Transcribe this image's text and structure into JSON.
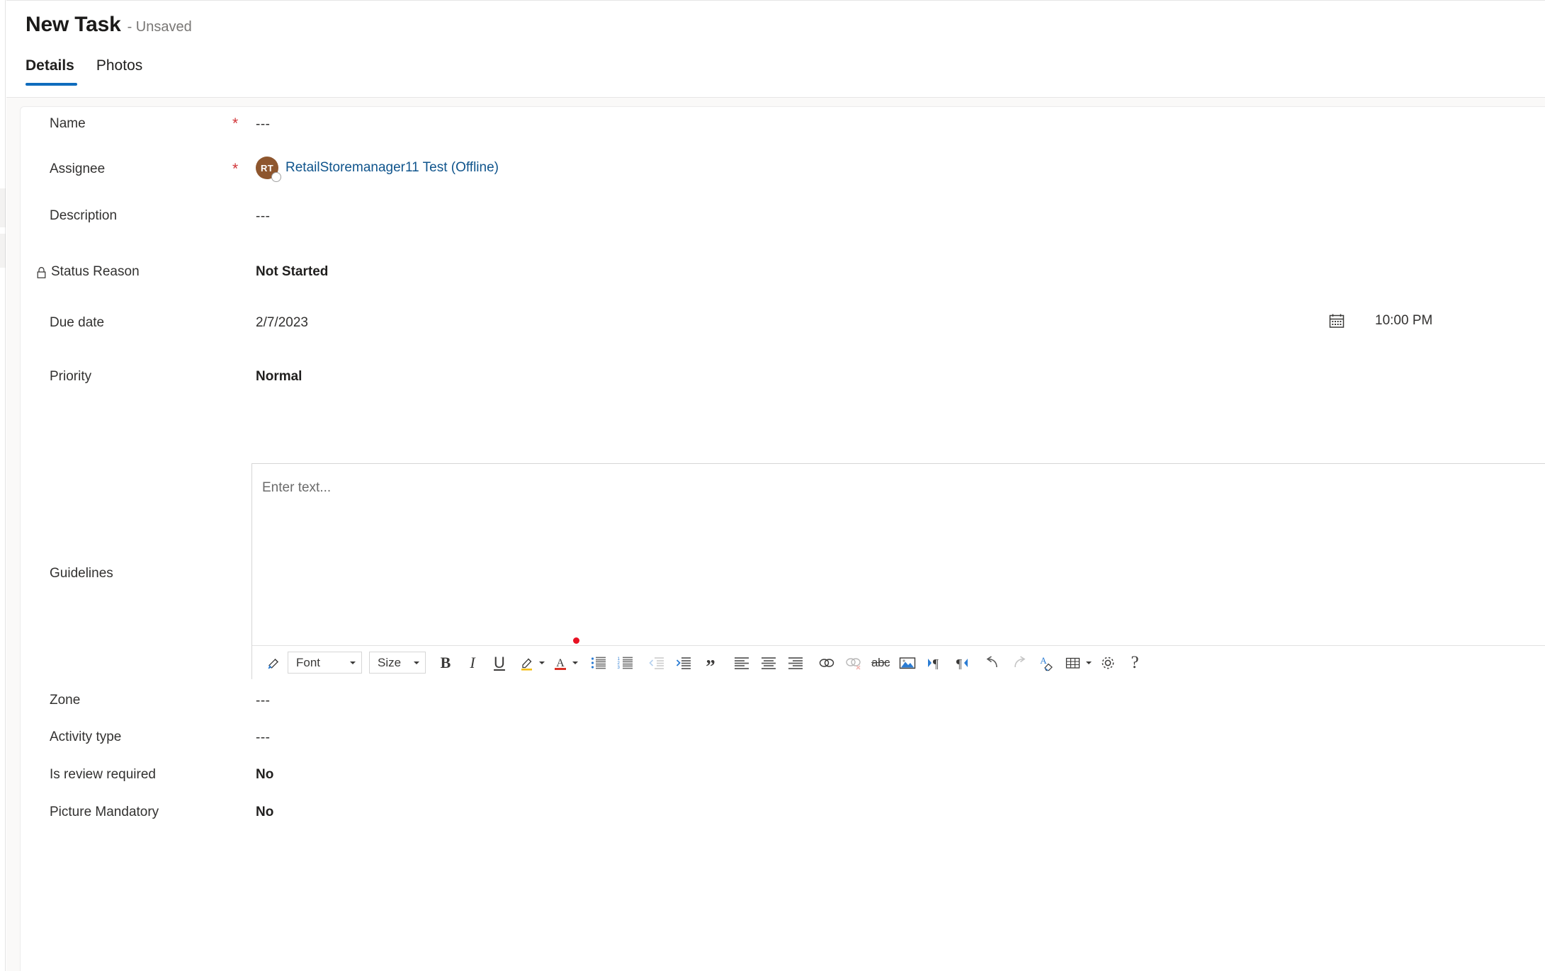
{
  "header": {
    "title": "New Task",
    "subtitle": "- Unsaved",
    "tabs": [
      {
        "label": "Details",
        "active": true
      },
      {
        "label": "Photos",
        "active": false
      }
    ]
  },
  "form": {
    "fields": [
      {
        "label": "Name",
        "required": true,
        "value": "---",
        "style": "dashes"
      },
      {
        "label": "Assignee",
        "required": true,
        "value": "RetailStoremanager11 Test (Offline)",
        "avatar_initials": "RT",
        "presence": "offline",
        "style": "link"
      },
      {
        "label": "Description",
        "required": false,
        "value": "---",
        "style": "dashes"
      },
      {
        "label": "Status Reason",
        "required": false,
        "value": "Not Started",
        "locked": true,
        "style": "bold"
      },
      {
        "label": "Due date",
        "required": false,
        "value": "2/7/2023",
        "time": "10:00 PM",
        "style": "plain"
      },
      {
        "label": "Priority",
        "required": false,
        "value": "Normal",
        "style": "bold"
      },
      {
        "label": "Guidelines",
        "required": false,
        "value": "",
        "style": "richtext"
      },
      {
        "label": "Zone",
        "required": false,
        "value": "---",
        "style": "dashes"
      },
      {
        "label": "Activity type",
        "required": false,
        "value": "---",
        "style": "dashes"
      },
      {
        "label": "Is review required",
        "required": false,
        "value": "No",
        "style": "bold"
      },
      {
        "label": "Picture Mandatory",
        "required": false,
        "value": "No",
        "style": "bold"
      }
    ],
    "required_marker": "*"
  },
  "editor": {
    "placeholder": "Enter text...",
    "toolbar": {
      "font_label": "Font",
      "size_label": "Size",
      "buttons": [
        "format-painter",
        "bold",
        "italic",
        "underline",
        "text-highlight",
        "font-color",
        "bulleted-list",
        "numbered-list",
        "decrease-indent",
        "increase-indent",
        "blockquote",
        "align-left",
        "align-center",
        "align-right",
        "insert-link",
        "remove-link",
        "strikethrough",
        "insert-image",
        "ltr-direction",
        "rtl-direction",
        "undo",
        "redo",
        "clear-formatting",
        "insert-table",
        "editor-settings",
        "help"
      ]
    }
  },
  "colors": {
    "accent": "#0f6cbd",
    "link": "#0f548c",
    "required": "#d13438",
    "avatar_bg": "#8e562e",
    "highlight": "#f5bf14",
    "font_color_bar": "#d93025",
    "canvas": "#faf9f8"
  },
  "labels": {
    "dashes": "---"
  }
}
